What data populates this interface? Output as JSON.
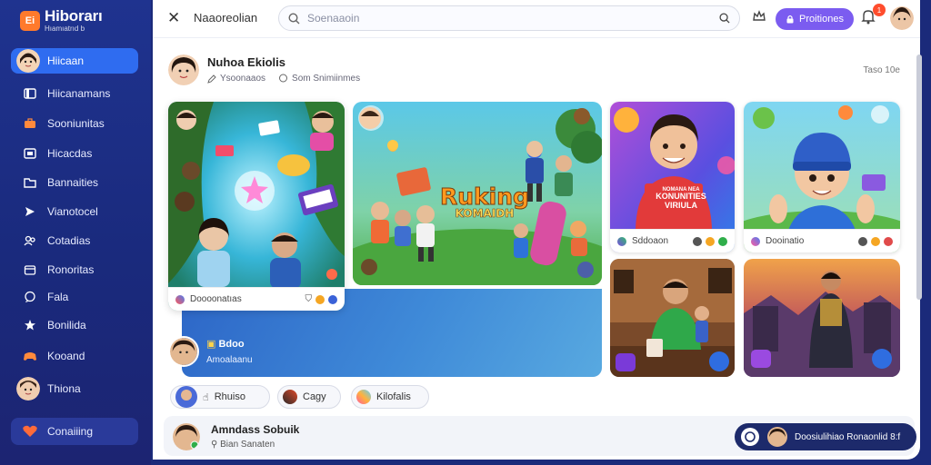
{
  "brand": {
    "logo_mark": "Ei",
    "name": "Hiborarı",
    "tagline": "Hıamıatrıd b"
  },
  "sidebar": {
    "items": [
      {
        "label": "Hiicaan",
        "icon": "avatar"
      },
      {
        "label": "Hiicanamans",
        "icon": "bookmark-icon"
      },
      {
        "label": "Sooniunitas",
        "icon": "briefcase-icon"
      },
      {
        "label": "Hicacdas",
        "icon": "tv-icon"
      },
      {
        "label": "Bannaities",
        "icon": "folder-icon"
      },
      {
        "label": "Vianotocel",
        "icon": "send-icon"
      },
      {
        "label": "Cotadias",
        "icon": "people-icon"
      },
      {
        "label": "Ronoritas",
        "icon": "calendar-icon"
      },
      {
        "label": "Fala",
        "icon": "chat-icon"
      },
      {
        "label": "Bonilida",
        "icon": "star-icon"
      },
      {
        "label": "Kooand",
        "icon": "gamepad-icon"
      },
      {
        "label": "Thiona",
        "icon": "avatar"
      },
      {
        "label": "Conaiiing",
        "icon": "heart-hands-icon"
      }
    ]
  },
  "topbar": {
    "title": "Naaoreolian",
    "search_placeholder": "Soenaaoin",
    "premium_label": "Proitiones",
    "notif_count": "1"
  },
  "post": {
    "author": "Nuhoa Ekiolis",
    "meta_left": "Ysoonaaos",
    "meta_right": "Som Snimiinmes",
    "more": "Taso 10e"
  },
  "cards": {
    "c1_footer": "Doooonatıas",
    "c2_title_line1": "Ruking",
    "c2_title_line2": "KOMAIDH",
    "c3_banner_line1": "NOMANA NEA",
    "c3_banner_line2": "KONUNITIES",
    "c3_banner_line3": "VIRIULA",
    "c3_footer": "Sddoaon",
    "c4_footer": "Dooinatio"
  },
  "stream": {
    "name": "Bdoo",
    "sub": "Amoalaanu"
  },
  "chips": [
    {
      "label": "Rhuiso"
    },
    {
      "label": "Cagy"
    },
    {
      "label": "Kilofalis"
    }
  ],
  "bottom": {
    "name": "Amndass Sobuik",
    "sub": "Bian Sanaten",
    "pill": "Doosiulihiao Ronaonlid 8:f"
  },
  "colors": {
    "sidebar": "#1f338f",
    "accent_active": "#2f6cf0",
    "premium": "#7b5cf0",
    "badge": "#ff4d2d"
  }
}
